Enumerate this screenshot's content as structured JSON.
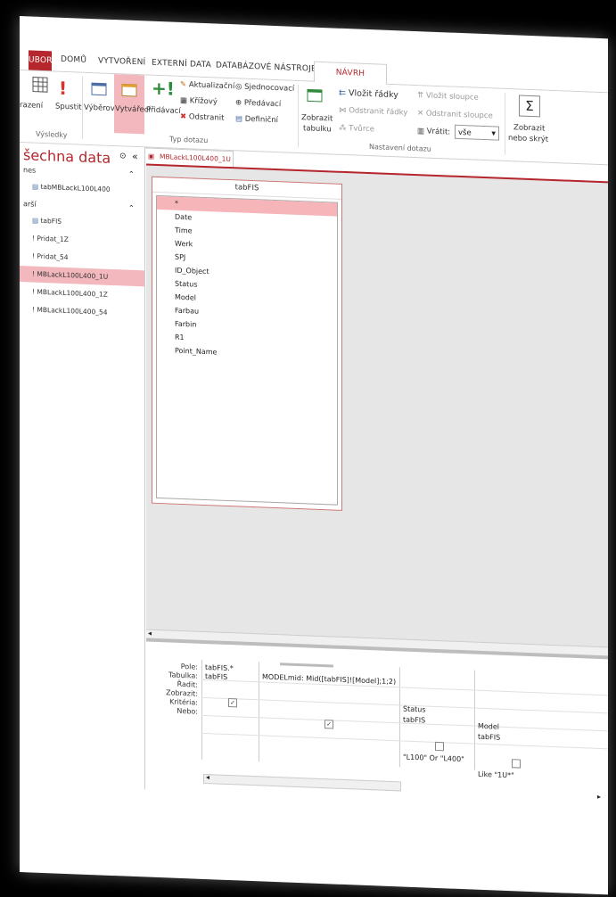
{
  "tabs": {
    "file": "UBOR",
    "home": "DOMŮ",
    "create": "VYTVOŘENÍ",
    "external": "EXTERNÍ DATA",
    "dbtools": "DATABÁZOVÉ NÁSTROJE",
    "design": "NÁVRH"
  },
  "ribbon": {
    "results": {
      "view": "razení",
      "run": "Spustit",
      "group": "Výsledky"
    },
    "query_type": {
      "select": "Výběrový",
      "make_table": "Vytvářecí",
      "append": "Přidávací",
      "update": "Aktualizační",
      "crosstab": "Křížový",
      "delete": "Odstranit",
      "union": "Sjednocovací",
      "passthrough": "Předávací",
      "data_def": "Definiční",
      "group": "Typ dotazu"
    },
    "setup": {
      "show_table_line1": "Zobrazit",
      "show_table_line2": "tabulku",
      "insert_rows": "Vložit řádky",
      "delete_rows": "Odstranit řádky",
      "builder": "Tvůrce",
      "insert_cols": "Vložit sloupce",
      "delete_cols": "Odstranit sloupce",
      "return_label": "Vrátit:",
      "return_value": "vše",
      "group": "Nastavení dotazu"
    },
    "showhide": {
      "line1": "Zobrazit",
      "line2": "nebo skrýt"
    }
  },
  "nav": {
    "title": "šechna data",
    "sec1": "nes",
    "item_table1": "tabMBLackL100L400",
    "sec2": "arší",
    "items": [
      "tabFIS",
      "Pridat_1Z",
      "Pridat_54",
      "MBLackL100L400_1U",
      "MBLackL100L400_1Z",
      "MBLackL100L400_54"
    ]
  },
  "doc_tab": "MBLackL100L400_1U",
  "table": {
    "name": "tabFIS",
    "fields": [
      "*",
      "Date",
      "Time",
      "Werk",
      "SPJ",
      "ID_Object",
      "Status",
      "Model",
      "Farbau",
      "Farbin",
      "R1",
      "Point_Name"
    ]
  },
  "qbe": {
    "labels": [
      "Pole:",
      "Tabulka:",
      "Řadit:",
      "Zobrazit:",
      "Kritéria:",
      "Nebo:"
    ],
    "col1": {
      "field": "tabFIS.*",
      "table": "tabFIS"
    },
    "col2": {
      "field": "MODELmid: Mid([tabFIS]![Model];1;2)"
    },
    "col3": {
      "field": "Status",
      "table": "tabFIS",
      "criteria": "\"L100\" Or \"L400\""
    },
    "col4": {
      "field": "Model",
      "table": "tabFIS",
      "criteria": "Like \"1U*\""
    }
  },
  "colors": {
    "accent": "#b5262d",
    "selected": "#f3b8bd"
  }
}
